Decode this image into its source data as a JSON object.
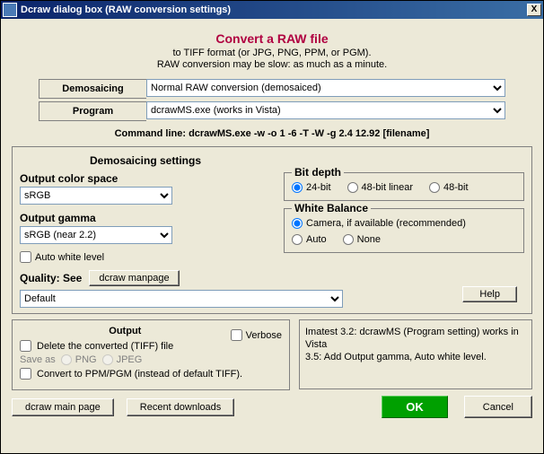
{
  "window": {
    "title": "Dcraw dialog box (RAW conversion settings)",
    "close": "X"
  },
  "head": {
    "title": "Convert a RAW file",
    "sub1": "to TIFF format (or JPG, PNG, PPM, or PGM).",
    "sub2": "RAW conversion may be slow:  as much as a minute."
  },
  "top": {
    "demosaic_label": "Demosaicing",
    "demosaic_value": "Normal RAW conversion  (demosaiced)",
    "program_label": "Program",
    "program_value": "dcrawMS.exe (works in Vista)"
  },
  "cmdline": "Command line:    dcrawMS.exe  -w    -o 1 -6 -T  -W   -g 2.4 12.92   [filename]",
  "dem": {
    "heading": "Demosaicing settings",
    "ocs_label": "Output color space",
    "ocs_value": "sRGB",
    "og_label": "Output gamma",
    "og_value": "sRGB (near 2.2)",
    "awl": "Auto white level",
    "quality_label": "Quality:  See",
    "manpage_btn": "dcraw manpage",
    "quality_value": "Default",
    "bitdepth": {
      "legend": "Bit depth",
      "o1": "24-bit",
      "o2": "48-bit linear",
      "o3": "48-bit"
    },
    "wb": {
      "legend": "White Balance",
      "o1": "Camera, if available (recommended)",
      "o2": "Auto",
      "o3": "None"
    },
    "help": "Help"
  },
  "out": {
    "heading": "Output",
    "verbose": "Verbose",
    "del": "Delete the converted (TIFF) file",
    "saveas": "Save as",
    "png": "PNG",
    "jpeg": "JPEG",
    "ppm": "Convert to PPM/PGM (instead of default TIFF)."
  },
  "info": {
    "l1": "Imatest 3.2:  dcrawMS (Program setting) works in Vista",
    "l2": "3.5: Add Output gamma, Auto white level."
  },
  "btns": {
    "mainpage": "dcraw main page",
    "recent": "Recent downloads",
    "ok": "OK",
    "cancel": "Cancel"
  }
}
